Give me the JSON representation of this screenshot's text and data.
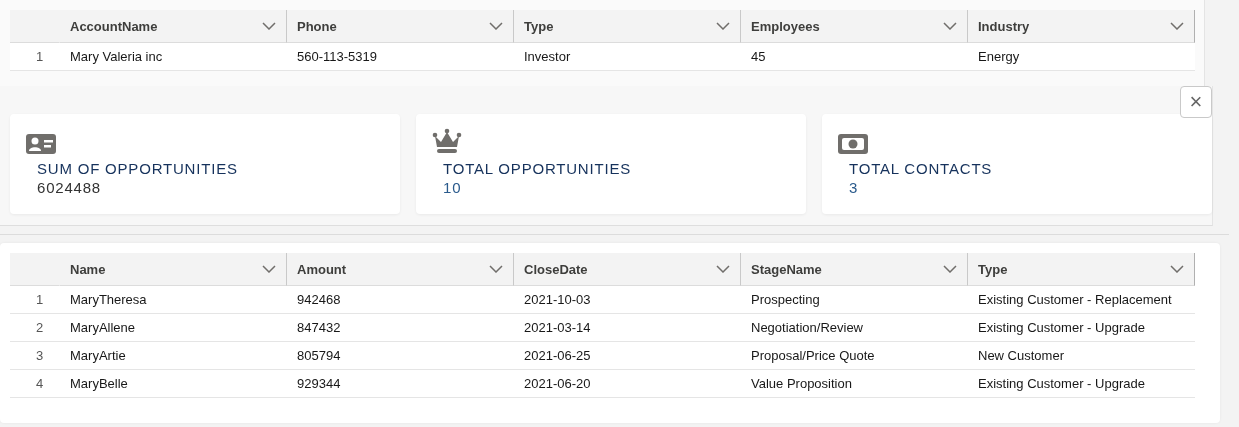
{
  "account_table": {
    "columns": [
      "AccountName",
      "Phone",
      "Type",
      "Employees",
      "Industry"
    ],
    "rows": [
      {
        "number": "1",
        "cells": [
          "Mary Valeria inc",
          "560-113-5319",
          "Investor",
          "45",
          "Energy"
        ]
      }
    ]
  },
  "close_button": {
    "label": "×"
  },
  "stats": [
    {
      "kind": "contact-card",
      "title": "SUM OF OPPORTUNITIES",
      "value": "6024488",
      "color": "#333333"
    },
    {
      "kind": "crown",
      "title": "TOTAL OPPORTUNITIES",
      "value": "10",
      "color": "#2a5a8c"
    },
    {
      "kind": "money",
      "title": "TOTAL CONTACTS",
      "value": "3",
      "color": "#2a5a8c"
    }
  ],
  "opportunity_table": {
    "columns": [
      "Name",
      "Amount",
      "CloseDate",
      "StageName",
      "Type"
    ],
    "rows": [
      {
        "number": "1",
        "cells": [
          "MaryTheresa",
          "942468",
          "2021-10-03",
          "Prospecting",
          "Existing Customer - Replacement"
        ]
      },
      {
        "number": "2",
        "cells": [
          "MaryAllene",
          "847432",
          "2021-03-14",
          "Negotiation/Review",
          "Existing Customer - Upgrade"
        ]
      },
      {
        "number": "3",
        "cells": [
          "MaryArtie",
          "805794",
          "2021-06-25",
          "Proposal/Price Quote",
          "New Customer"
        ]
      },
      {
        "number": "4",
        "cells": [
          "MaryBelle",
          "929344",
          "2021-06-20",
          "Value Proposition",
          "Existing Customer - Upgrade"
        ]
      }
    ]
  }
}
